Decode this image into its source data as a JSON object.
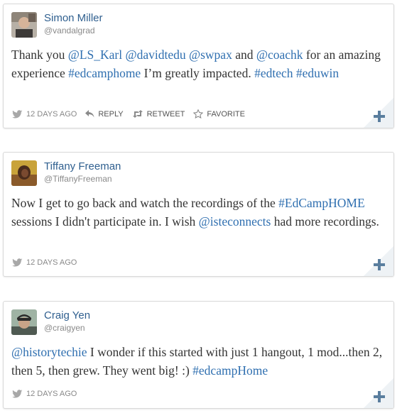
{
  "colors": {
    "name": "#2f5f8f",
    "link": "#2f6fb0",
    "text": "#333333",
    "meta": "#888888",
    "plus": "#5a7e9e",
    "corner": "#eef2f5"
  },
  "tweets": [
    {
      "name": "Simon Miller",
      "handle": "@vandalgrad",
      "avatar_icon": "avatar-photo-icon",
      "tokens": [
        {
          "t": "Thank you ",
          "link": false
        },
        {
          "t": "@LS_Karl",
          "link": true
        },
        {
          "t": " ",
          "link": false
        },
        {
          "t": "@davidtedu",
          "link": true
        },
        {
          "t": " ",
          "link": false
        },
        {
          "t": "@swpax",
          "link": true
        },
        {
          "t": " and ",
          "link": false
        },
        {
          "t": "@coachk",
          "link": true
        },
        {
          "t": " for an amazing experience ",
          "link": false
        },
        {
          "t": "#edcamphome",
          "link": true
        },
        {
          "t": " I’m greatly impacted. ",
          "link": false
        },
        {
          "t": "#edtech",
          "link": true
        },
        {
          "t": " ",
          "link": false
        },
        {
          "t": "#eduwin",
          "link": true
        }
      ],
      "time": "12 DAYS AGO",
      "actions": [
        {
          "label": "REPLY",
          "icon": "reply-icon"
        },
        {
          "label": "RETWEET",
          "icon": "retweet-icon"
        },
        {
          "label": "FAVORITE",
          "icon": "star-icon"
        }
      ]
    },
    {
      "name": "Tiffany Freeman",
      "handle": "@TiffanyFreeman",
      "avatar_icon": "avatar-photo-icon",
      "tokens": [
        {
          "t": "Now I get to go back and watch the recordings of the ",
          "link": false
        },
        {
          "t": "#EdCampHOME",
          "link": true
        },
        {
          "t": " sessions I didn't participate in. I wish ",
          "link": false
        },
        {
          "t": "@isteconnects",
          "link": true
        },
        {
          "t": " had more recordings.",
          "link": false
        }
      ],
      "time": "12 DAYS AGO",
      "actions": []
    },
    {
      "name": "Craig Yen",
      "handle": "@craigyen",
      "avatar_icon": "avatar-photo-icon",
      "tokens": [
        {
          "t": "@historytechie",
          "link": true
        },
        {
          "t": " I wonder if this started with just 1 hangout, 1 mod...then 2, then 5, then grew. They went big! :) ",
          "link": false
        },
        {
          "t": "#edcampHome",
          "link": true
        }
      ],
      "time": "12 DAYS AGO",
      "actions": []
    }
  ]
}
